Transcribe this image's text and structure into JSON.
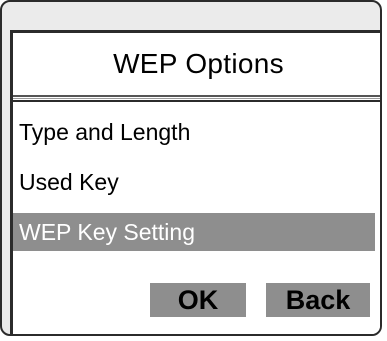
{
  "screen": {
    "title": "WEP Options"
  },
  "menu": {
    "items": [
      {
        "label": "Type and Length",
        "selected": false
      },
      {
        "label": "Used Key",
        "selected": false
      },
      {
        "label": "WEP Key Setting",
        "selected": true
      }
    ]
  },
  "softkeys": {
    "ok_label": "OK",
    "back_label": "Back"
  },
  "colors": {
    "selection": "#8e8e8e",
    "frame": "#2b2b2b",
    "bezel": "#ebebeb"
  }
}
